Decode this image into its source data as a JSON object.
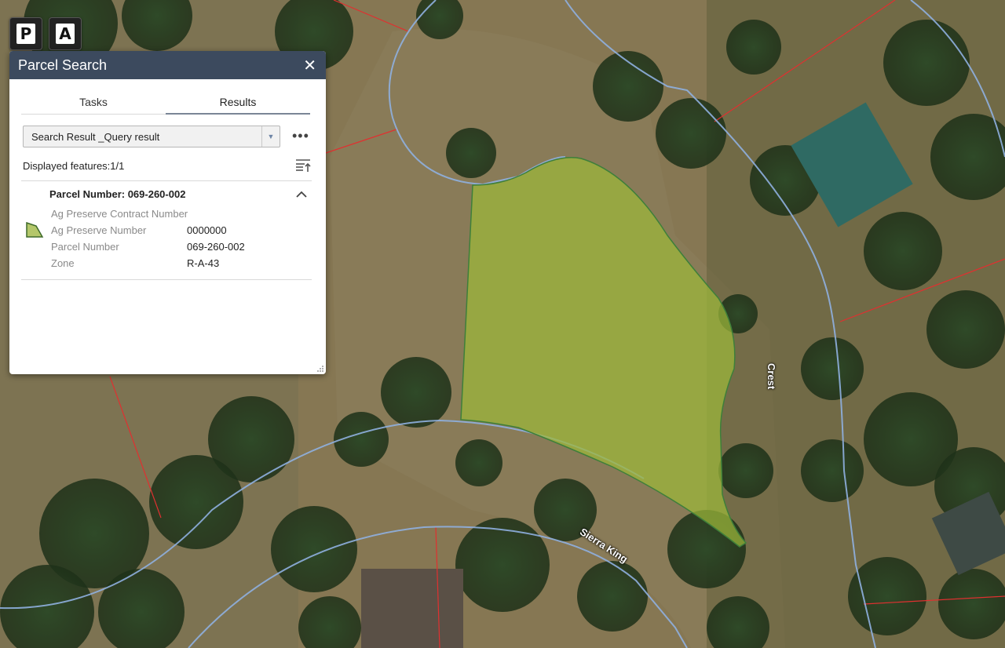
{
  "map": {
    "street_labels": [
      "Crest",
      "Sierra King"
    ],
    "parcel_fill_color": "#9cb83a",
    "parcel_line_color": "#3e7f3a",
    "road_line_color": "#8fb0e0",
    "lot_line_color": "#e03030"
  },
  "toolbar": {
    "parcel_tool": "P",
    "address_tool": "A"
  },
  "panel": {
    "title": "Parcel Search",
    "close_icon": "close-icon",
    "tabs": [
      {
        "label": "Tasks",
        "active": false
      },
      {
        "label": "Results",
        "active": true
      }
    ],
    "layer_select": {
      "value": "Search Result _Query result"
    },
    "more_options": "•••",
    "displayed_features": "Displayed features:1/1",
    "result": {
      "title": "Parcel Number: 069-260-002",
      "attributes": [
        {
          "key": "Ag Preserve Contract Number",
          "value": ""
        },
        {
          "key": "Ag Preserve Number",
          "value": "0000000"
        },
        {
          "key": "Parcel Number",
          "value": "069-260-002"
        },
        {
          "key": "Zone",
          "value": "R-A-43"
        }
      ]
    },
    "header_color": "#3c4a5e"
  }
}
